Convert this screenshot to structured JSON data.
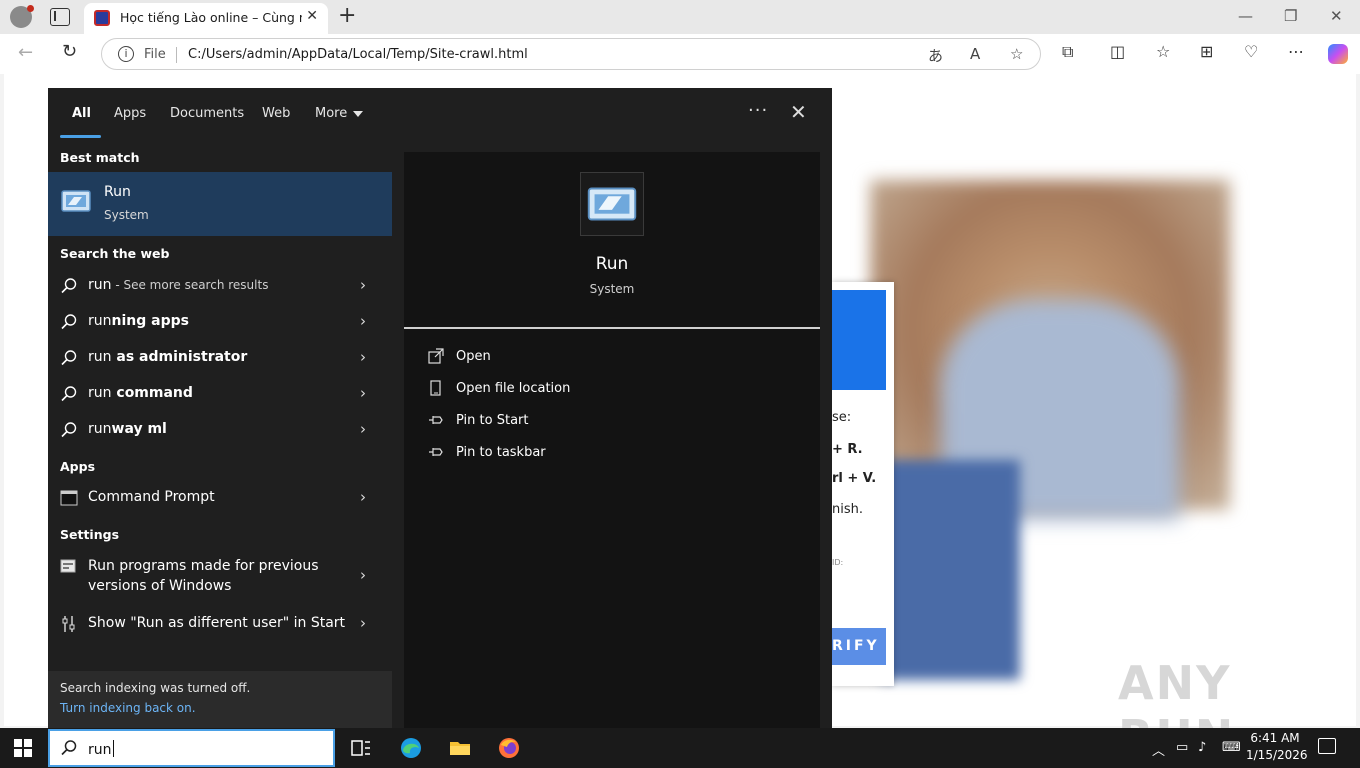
{
  "browser": {
    "tab_title": "Học tiếng Lào online – Cùng nhau",
    "omnibox": {
      "scheme_label": "File",
      "url": "C:/Users/admin/AppData/Local/Temp/Site-crawl.html"
    },
    "icons": [
      "profile-icon",
      "tab-actions-icon",
      "close-tab-icon",
      "new-tab-icon",
      "minimize-icon",
      "restore-icon",
      "window-close-icon",
      "back-icon",
      "reload-icon",
      "translate-icon",
      "read-aloud-icon",
      "favorite-icon",
      "extensions-icon",
      "split-screen-icon",
      "favorites-icon",
      "collections-icon",
      "browser-essentials-icon",
      "settings-more-icon",
      "copilot-icon"
    ]
  },
  "page_dialog": {
    "fragments": [
      "se:",
      "+ R.",
      "rl + V.",
      "nish."
    ],
    "small_text": "ID:",
    "button_fragment": "RIFY"
  },
  "watermark": "ANY RUN",
  "search_panel": {
    "filters": [
      "All",
      "Apps",
      "Documents",
      "Web",
      "More"
    ],
    "active_filter": "All",
    "best_match_header": "Best match",
    "best_match": {
      "title": "Run",
      "subtitle": "System"
    },
    "web_header": "Search the web",
    "web_results": [
      {
        "prefix": "run",
        "bold": "",
        "suffix": " - See more search results"
      },
      {
        "prefix": "run",
        "bold": "ning apps",
        "suffix": ""
      },
      {
        "prefix": "run",
        "bold": " as administrator",
        "suffix": ""
      },
      {
        "prefix": "run",
        "bold": " command",
        "suffix": ""
      },
      {
        "prefix": "run",
        "bold": "way ml",
        "suffix": ""
      }
    ],
    "apps_header": "Apps",
    "apps": [
      {
        "label": "Command Prompt"
      }
    ],
    "settings_header": "Settings",
    "settings": [
      {
        "label": "Run programs made for previous versions of Windows"
      },
      {
        "label": "Show \"Run as different user\" in Start"
      }
    ],
    "footer": {
      "text": "Search indexing was turned off.",
      "link": "Turn indexing back on."
    },
    "detail": {
      "title": "Run",
      "subtitle": "System",
      "actions": [
        "Open",
        "Open file location",
        "Pin to Start",
        "Pin to taskbar"
      ]
    },
    "colors": {
      "panel_bg": "#1f1f1f",
      "selected_bg": "#1f3c5c",
      "accent": "#4aa0e6",
      "link": "#6cb4f5"
    }
  },
  "taskbar": {
    "search_value": "run",
    "apps": [
      "task-view-icon",
      "edge-icon",
      "file-explorer-icon",
      "firefox-icon"
    ],
    "clock": {
      "time": "6:41 AM",
      "date": "1/15/2026"
    }
  }
}
